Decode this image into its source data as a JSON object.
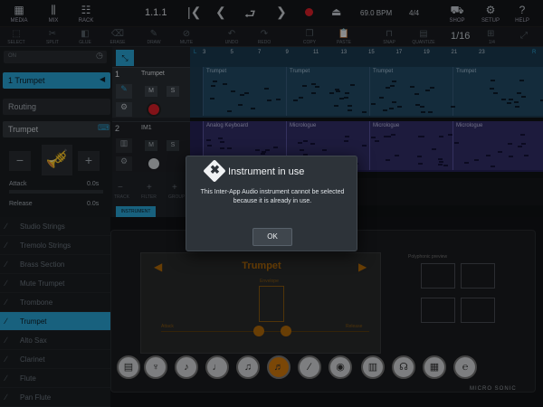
{
  "topbar": {
    "media": "MEDIA",
    "mix": "MIX",
    "rack": "RACK",
    "position": "1.1.1",
    "bpm": "69.0 BPM",
    "signature": "4/4",
    "shop": "SHOP",
    "setup": "SETUP",
    "help": "HELP"
  },
  "toolbar": {
    "tools": [
      "SELECT",
      "SPLIT",
      "GLUE",
      "ERASE",
      "DRAW",
      "MUTE",
      "UNDO",
      "REDO",
      "COPY",
      "PASTE",
      "SNAP",
      "QUANTIZE"
    ],
    "grid": "1/16",
    "edit_label": "1/4"
  },
  "left": {
    "search_placeholder": "ON",
    "track_name": "1 Trumpet",
    "routing": "Routing",
    "instrument": "Trumpet",
    "attack_label": "Attack",
    "attack_value": "0.0s",
    "release_label": "Release",
    "release_value": "0.0s"
  },
  "tracks": [
    {
      "num": "1",
      "name": "Trumpet",
      "m": "M",
      "s": "S"
    },
    {
      "num": "2",
      "name": "IM1",
      "m": "M",
      "s": "S"
    }
  ],
  "track_controls": [
    "TRACK",
    "FILTER",
    "GROUP"
  ],
  "section_button": "INSTRUMENT",
  "ruler": [
    "L",
    "3",
    "5",
    "7",
    "9",
    "11",
    "13",
    "15",
    "17",
    "19",
    "21",
    "23",
    "R"
  ],
  "clips_row1": [
    "Trumpet",
    "Trumpet",
    "Trumpet",
    "Trumpet"
  ],
  "clips_row2": [
    "Analog Keyboard",
    "Micrologue",
    "Micrologue",
    "Micrologue"
  ],
  "presets": [
    "Studio Strings",
    "Tremolo Strings",
    "Brass Section",
    "Mute Trumpet",
    "Trombone",
    "Trumpet",
    "Alto Sax",
    "Clarinet",
    "Flute",
    "Pan Flute"
  ],
  "instrument_panel": {
    "name": "Trumpet",
    "envelope": "Envelope",
    "attack": "Attack",
    "release": "Release",
    "polyphonic": "Polyphonic preview",
    "brand": "MICRO SONIC"
  },
  "dialog": {
    "title": "Instrument in use",
    "message": "This Inter-App Audio instrument cannot be selected because it is already in use.",
    "ok": "OK"
  },
  "colors": {
    "accent": "#2aa7d9",
    "record": "#e0202a",
    "orange": "#f29b0f",
    "clip_blue": "#21455f",
    "clip_purple": "#2f2c63"
  }
}
